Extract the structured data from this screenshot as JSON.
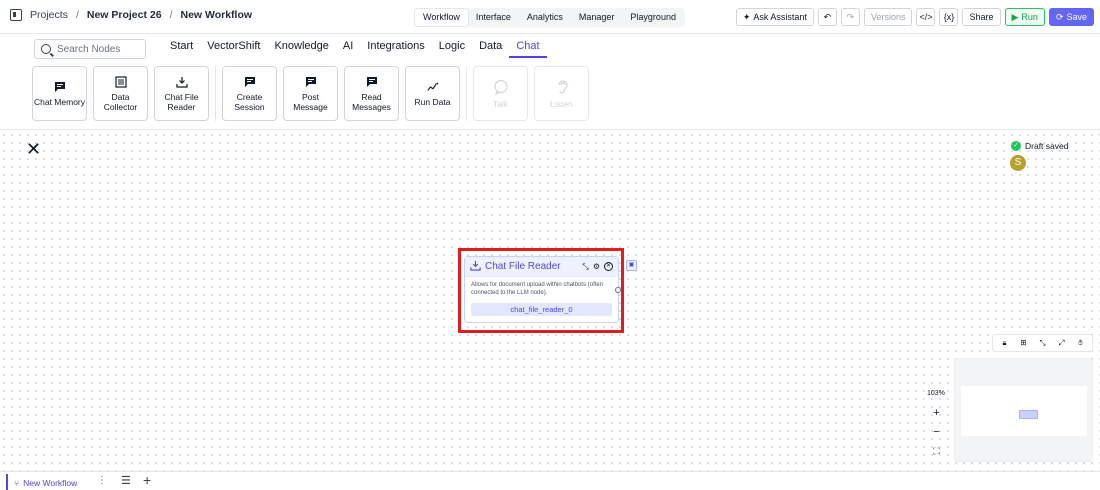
{
  "breadcrumb": {
    "projects": "Projects",
    "project": "New Project 26",
    "workflow": "New Workflow",
    "separator": "/"
  },
  "view_tabs": [
    "Workflow",
    "Interface",
    "Analytics",
    "Manager",
    "Playground"
  ],
  "active_view_tab": "Workflow",
  "header_actions": {
    "ask_assistant": "Ask Assistant",
    "undo": "↶",
    "redo": "↷",
    "versions": "Versions",
    "code": "</>",
    "variables": "{x}",
    "share": "Share",
    "run": "Run",
    "save": "Save"
  },
  "search": {
    "placeholder": "Search Nodes"
  },
  "categories": [
    "Start",
    "VectorShift",
    "Knowledge",
    "AI",
    "Integrations",
    "Logic",
    "Data",
    "Chat"
  ],
  "active_category": "Chat",
  "node_palette": [
    {
      "label": "Chat Memory",
      "icon": "message-square-icon",
      "enabled": true
    },
    {
      "label": "Data Collector",
      "icon": "form-icon",
      "enabled": true
    },
    {
      "label": "Chat File Reader",
      "icon": "download-icon",
      "enabled": true
    },
    {
      "label": "Create Session",
      "icon": "message-square-icon",
      "enabled": true
    },
    {
      "label": "Post Message",
      "icon": "message-square-icon",
      "enabled": true
    },
    {
      "label": "Read Messages",
      "icon": "message-square-icon",
      "enabled": true
    },
    {
      "label": "Run Data",
      "icon": "sparkline-icon",
      "enabled": true
    },
    {
      "label": "Talk",
      "icon": "chat-bubble-icon",
      "enabled": false
    },
    {
      "label": "Listen",
      "icon": "ear-icon",
      "enabled": false
    }
  ],
  "canvas": {
    "draft_status": "Draft saved",
    "avatar_initial": "S",
    "zoom": "103%"
  },
  "selected_node": {
    "title": "Chat File Reader",
    "description": "Allows for document upload within chatbots (often connected to the LLM node).",
    "name": "chat_file_reader_0"
  },
  "bottom_bar": {
    "tab": "New Workflow"
  },
  "colors": {
    "accent": "#4f46e5",
    "run": "#16a34a",
    "save": "#6366f1",
    "highlight": "#e11d1d",
    "avatar": "#b8a12e"
  }
}
